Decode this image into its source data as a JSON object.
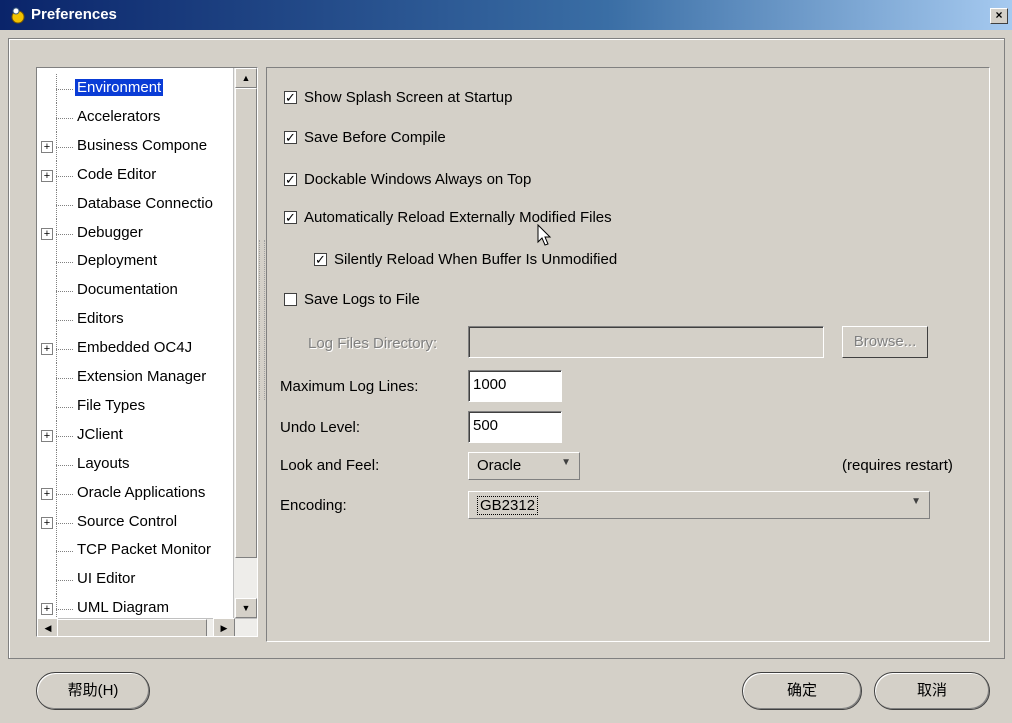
{
  "window": {
    "title": "Preferences",
    "close_label": "×"
  },
  "tree": {
    "items": [
      {
        "label": "Environment",
        "expandable": false,
        "selected": true
      },
      {
        "label": "Accelerators",
        "expandable": false
      },
      {
        "label": "Business Compone",
        "expandable": true
      },
      {
        "label": "Code Editor",
        "expandable": true
      },
      {
        "label": "Database Connectio",
        "expandable": false
      },
      {
        "label": "Debugger",
        "expandable": true
      },
      {
        "label": "Deployment",
        "expandable": false
      },
      {
        "label": "Documentation",
        "expandable": false
      },
      {
        "label": "Editors",
        "expandable": false
      },
      {
        "label": "Embedded OC4J",
        "expandable": true
      },
      {
        "label": "Extension Manager",
        "expandable": false
      },
      {
        "label": "File Types",
        "expandable": false
      },
      {
        "label": "JClient",
        "expandable": true
      },
      {
        "label": "Layouts",
        "expandable": false
      },
      {
        "label": "Oracle Applications",
        "expandable": true
      },
      {
        "label": "Source Control",
        "expandable": true
      },
      {
        "label": "TCP Packet Monitor",
        "expandable": false
      },
      {
        "label": "UI Editor",
        "expandable": false
      },
      {
        "label": "UML Diagram",
        "expandable": true
      }
    ],
    "expand_glyph": "+",
    "scroll_up": "▲",
    "scroll_down": "▼",
    "scroll_left": "◀",
    "scroll_right": "▶"
  },
  "settings": {
    "checkboxes": [
      {
        "label": "Show Splash Screen at Startup",
        "checked": true
      },
      {
        "label": "Save Before Compile",
        "checked": true
      },
      {
        "label": "Dockable Windows Always on Top",
        "checked": true
      },
      {
        "label": "Automatically Reload Externally Modified Files",
        "checked": true
      },
      {
        "label": "Silently Reload When Buffer Is Unmodified",
        "checked": true
      },
      {
        "label": "Save Logs to File",
        "checked": false
      }
    ],
    "check_glyph": "✓",
    "log_dir_label": "Log Files Directory:",
    "log_dir_value": "",
    "browse_label": "Browse...",
    "max_log_label": "Maximum Log Lines:",
    "max_log_value": "1000",
    "undo_label": "Undo Level:",
    "undo_value": "500",
    "look_label": "Look and Feel:",
    "look_value": "Oracle",
    "restart_note": "(requires restart)",
    "encoding_label": "Encoding:",
    "encoding_value": "GB2312",
    "dropdown_arrow": "▼"
  },
  "footer": {
    "help_label": "帮助(H)",
    "ok_label": "确定",
    "cancel_label": "取消"
  },
  "colors": {
    "selection": "#0a3cd6",
    "title_start": "#0a246a",
    "face": "#d4d0c8"
  }
}
